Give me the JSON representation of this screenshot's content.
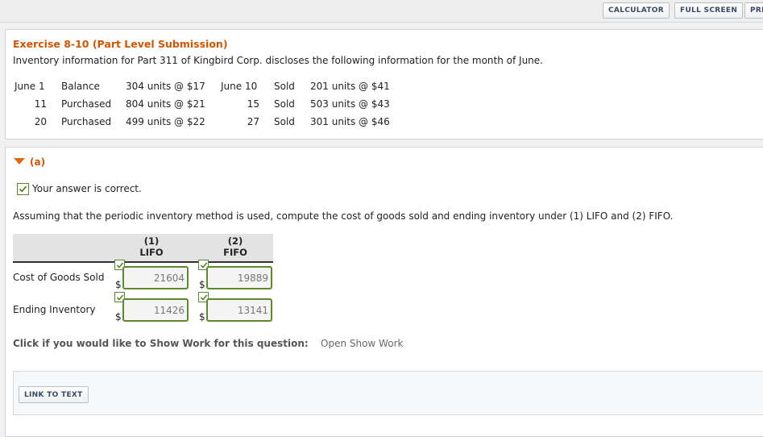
{
  "toolbar": {
    "calculator": "CALCULATOR",
    "full_screen": "FULL SCREEN",
    "print": "PRI"
  },
  "exercise": {
    "title": "Exercise 8-10 (Part Level Submission)",
    "description": "Inventory information for Part 311 of Kingbird Corp. discloses the following information for the month of June."
  },
  "inventory": [
    {
      "d1": "June 1",
      "t1": "Balance",
      "q1": "304 units @ $17",
      "d2": "June 10",
      "t2": "Sold",
      "q2": "201 units @ $41"
    },
    {
      "d1": "11",
      "t1": "Purchased",
      "q1": "804 units @ $21",
      "d2": "15",
      "t2": "Sold",
      "q2": "503 units @ $43"
    },
    {
      "d1": "20",
      "t1": "Purchased",
      "q1": "499 units @ $22",
      "d2": "27",
      "t2": "Sold",
      "q2": "301 units @ $46"
    }
  ],
  "part": {
    "label": "(a)",
    "correct_text": "Your answer is correct.",
    "question": "Assuming that the periodic inventory method is used, compute the cost of goods sold and ending inventory under (1) LIFO and (2) FIFO.",
    "col1_num": "(1)",
    "col1_name": "LIFO",
    "col2_num": "(2)",
    "col2_name": "FIFO",
    "currency": "$",
    "rows": [
      {
        "label": "Cost of Goods Sold",
        "lifo": "21604",
        "fifo": "19889"
      },
      {
        "label": "Ending Inventory",
        "lifo": "11426",
        "fifo": "13141"
      }
    ]
  },
  "show_work": {
    "prompt": "Click if you would like to Show Work for this question:",
    "link": "Open Show Work"
  },
  "link_to_text": "LINK TO TEXT",
  "colors": {
    "accent": "#d45500",
    "correct_green": "#5d8a2a"
  }
}
